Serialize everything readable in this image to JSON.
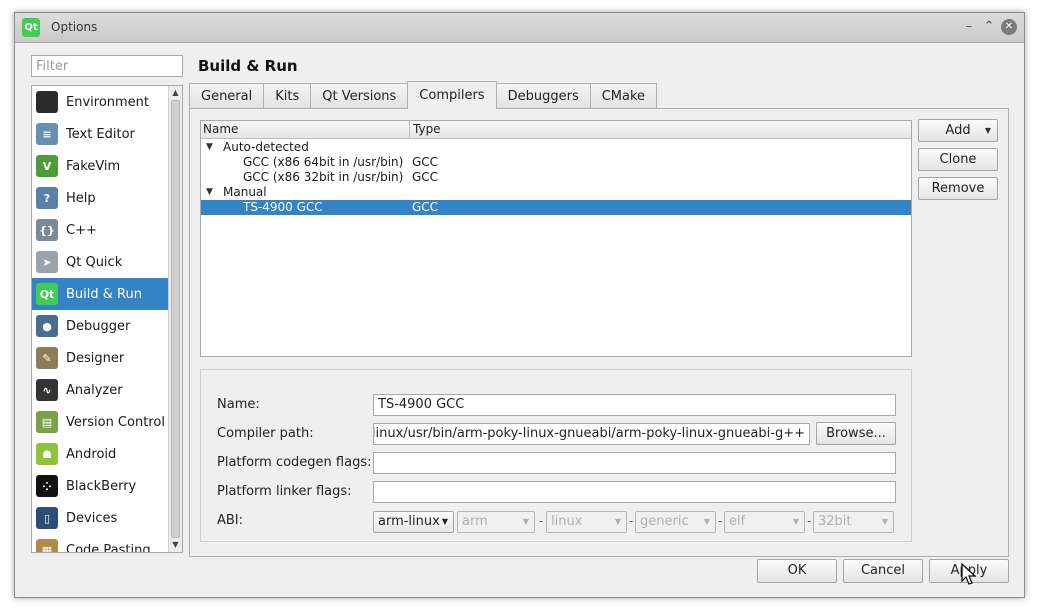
{
  "window": {
    "title": "Options",
    "logo_text": "Qt"
  },
  "filter": {
    "placeholder": "Filter"
  },
  "categories": [
    {
      "label": "Environment",
      "icon": "monitor-icon",
      "color": "#2b2b2b",
      "glyph": ""
    },
    {
      "label": "Text Editor",
      "icon": "text-editor-icon",
      "color": "#6a8fb5",
      "glyph": "≡"
    },
    {
      "label": "FakeVim",
      "icon": "fakevim-icon",
      "color": "#4f9d3a",
      "glyph": "V"
    },
    {
      "label": "Help",
      "icon": "help-icon",
      "color": "#5a7fa8",
      "glyph": "?"
    },
    {
      "label": "C++",
      "icon": "braces-icon",
      "color": "#7a8a99",
      "glyph": "{}"
    },
    {
      "label": "Qt Quick",
      "icon": "paper-plane-icon",
      "color": "#9aa3ab",
      "glyph": "➤"
    },
    {
      "label": "Build & Run",
      "icon": "qt-build-icon",
      "color": "#41cd52",
      "glyph": "Qt"
    },
    {
      "label": "Debugger",
      "icon": "debugger-icon",
      "color": "#4d6b8f",
      "glyph": "●"
    },
    {
      "label": "Designer",
      "icon": "designer-icon",
      "color": "#8e7b5a",
      "glyph": "✎"
    },
    {
      "label": "Analyzer",
      "icon": "analyzer-icon",
      "color": "#333333",
      "glyph": "∿"
    },
    {
      "label": "Version Control",
      "icon": "version-control-icon",
      "color": "#7aa04a",
      "glyph": "▤"
    },
    {
      "label": "Android",
      "icon": "android-icon",
      "color": "#8fc33a",
      "glyph": "☗"
    },
    {
      "label": "BlackBerry",
      "icon": "blackberry-icon",
      "color": "#111111",
      "glyph": "⁘"
    },
    {
      "label": "Devices",
      "icon": "devices-icon",
      "color": "#2d4d78",
      "glyph": "▯"
    },
    {
      "label": "Code Pasting",
      "icon": "code-pasting-icon",
      "color": "#b08a4a",
      "glyph": "▦"
    }
  ],
  "selected_category": "Build & Run",
  "page_title": "Build & Run",
  "tabs": [
    "General",
    "Kits",
    "Qt Versions",
    "Compilers",
    "Debuggers",
    "CMake"
  ],
  "active_tab": "Compilers",
  "compilers_table": {
    "columns": [
      "Name",
      "Type"
    ],
    "groups": [
      {
        "label": "Auto-detected",
        "items": [
          {
            "name": "GCC (x86 64bit in /usr/bin)",
            "type": "GCC"
          },
          {
            "name": "GCC (x86 32bit in /usr/bin)",
            "type": "GCC"
          }
        ]
      },
      {
        "label": "Manual",
        "items": [
          {
            "name": "TS-4900 GCC",
            "type": "GCC"
          }
        ]
      }
    ]
  },
  "side_buttons": {
    "add": "Add",
    "clone": "Clone",
    "remove": "Remove"
  },
  "details": {
    "name_label": "Name:",
    "name_value": "TS-4900 GCC",
    "path_label": "Compiler path:",
    "path_value": "/sdk-linux/usr/bin/arm-poky-linux-gnueabi/arm-poky-linux-gnueabi-g++",
    "browse_label": "Browse...",
    "codegen_label": "Platform codegen flags:",
    "codegen_value": "",
    "linker_label": "Platform linker flags:",
    "linker_value": "",
    "abi_label": "ABI:",
    "abi": {
      "preset": "arm-linux",
      "arch": "arm",
      "os": "linux",
      "flavor": "generic",
      "format": "elf",
      "width": "32bit"
    }
  },
  "footer": {
    "ok": "OK",
    "cancel": "Cancel",
    "apply": "Apply"
  },
  "colors": {
    "selection": "#3483c6",
    "qt_green": "#41cd52"
  }
}
